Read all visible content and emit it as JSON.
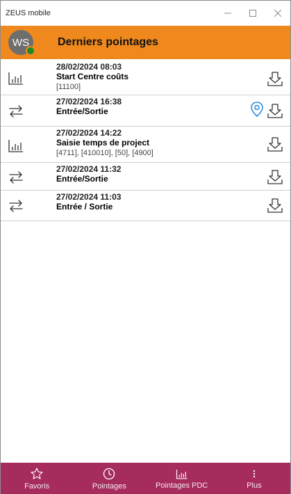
{
  "window": {
    "title": "ZEUS mobile"
  },
  "header": {
    "avatar_initials": "WS",
    "title": "Derniers pointages"
  },
  "entries": [
    {
      "kind": "cost",
      "date": "28/02/2024 08:03",
      "label": "Start Centre coûts",
      "detail": "[11100]",
      "has_location": false
    },
    {
      "kind": "transfer",
      "date": "27/02/2024 16:38",
      "label": "Entrée/Sortie",
      "detail": "",
      "has_location": true
    },
    {
      "kind": "cost",
      "date": "27/02/2024 14:22",
      "label": "Saisie temps de project",
      "detail": "[4711], [410010], [50], [4900]",
      "has_location": false
    },
    {
      "kind": "transfer",
      "date": "27/02/2024 11:32",
      "label": "Entrée/Sortie",
      "detail": "",
      "has_location": false
    },
    {
      "kind": "transfer",
      "date": "27/02/2024 11:03",
      "label": "Entrée / Sortie",
      "detail": "",
      "has_location": false
    }
  ],
  "nav": {
    "favoris": "Favoris",
    "pointages": "Pointages",
    "pointages_pdc": "Pointages PDC",
    "plus": "Plus"
  },
  "colors": {
    "header": "#f0891d",
    "nav": "#a62c5e",
    "status_dot": "#1e8a2a",
    "pin": "#2f8fe0"
  }
}
